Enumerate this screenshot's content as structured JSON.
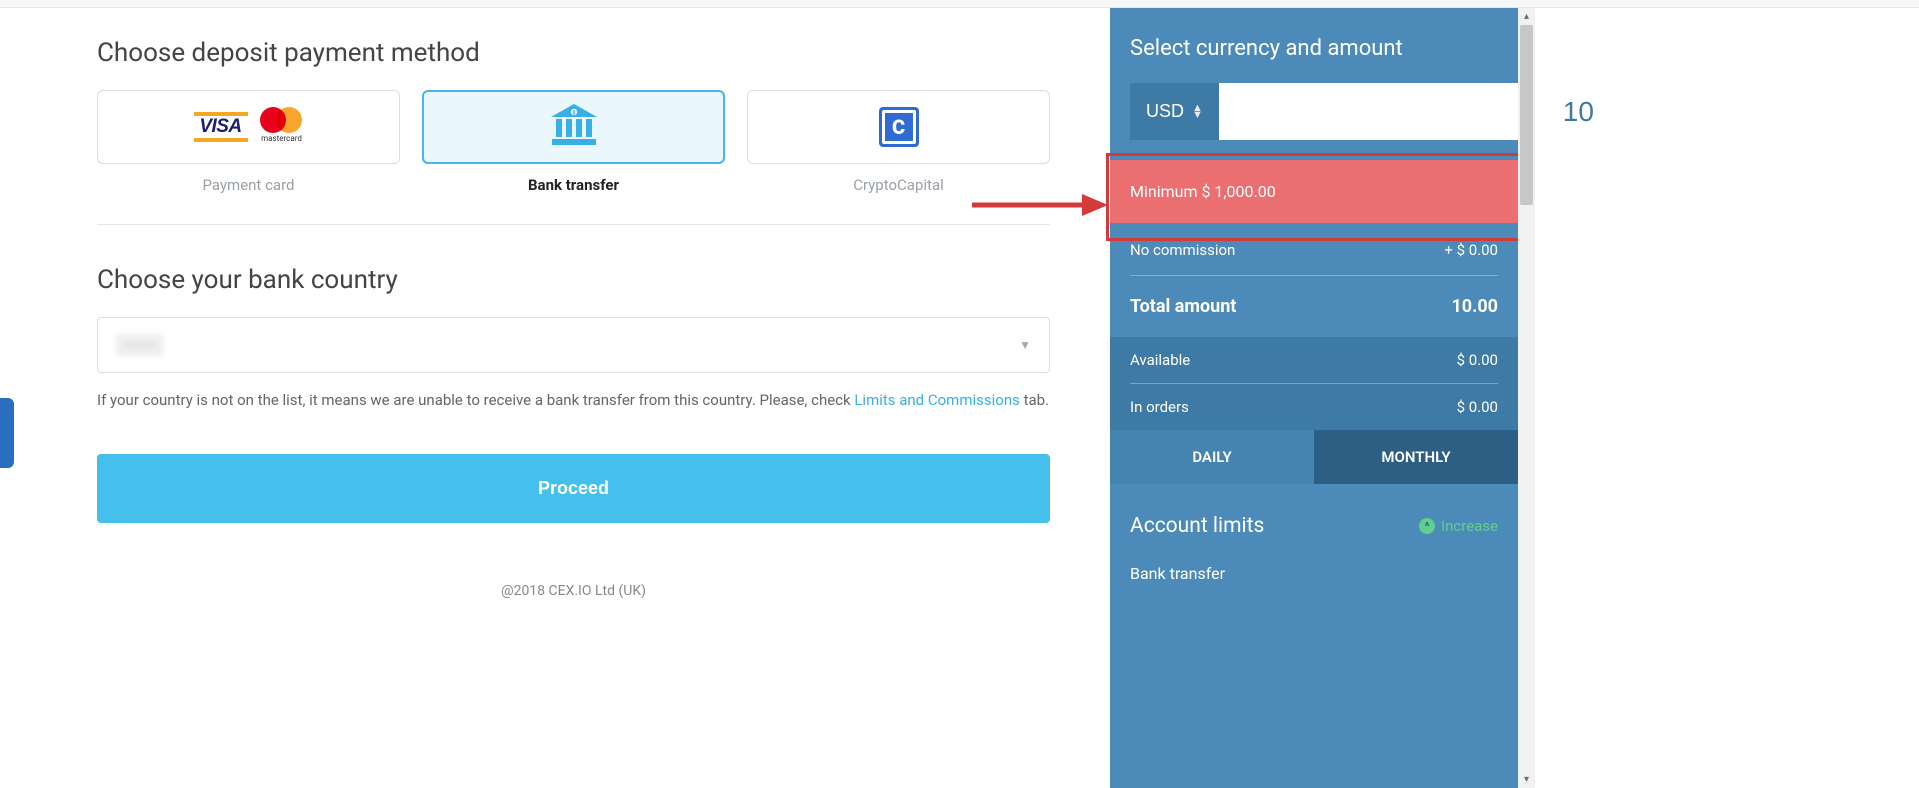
{
  "main": {
    "heading_method": "Choose deposit payment method",
    "methods": {
      "card": "Payment card",
      "bank": "Bank transfer",
      "crypto": "CryptoCapital",
      "visa_text": "VISA",
      "mc_text": "mastercard",
      "cc_text": "C"
    },
    "heading_country": "Choose your bank country",
    "country_blurred": "········",
    "hint_pre": "If your country is not on the list, it means we are unable to receive a bank transfer from this country. Please, check ",
    "hint_link": "Limits and Commissions",
    "hint_post": " tab.",
    "proceed": "Proceed",
    "footer": "@2018 CEX.IO Ltd (UK)"
  },
  "panel": {
    "title": "Select currency and amount",
    "currency": "USD",
    "amount": "10",
    "warning": "Minimum $ 1,000.00",
    "no_commission_label": "No commission",
    "no_commission_value": "+ $ 0.00",
    "total_label": "Total amount",
    "total_value": "10.00",
    "available_label": "Available",
    "available_value": "$ 0.00",
    "inorders_label": "In orders",
    "inorders_value": "$ 0.00",
    "tab_daily": "DAILY",
    "tab_monthly": "MONTHLY",
    "account_limits": "Account limits",
    "increase": "Increase",
    "bank_transfer": "Bank transfer"
  }
}
